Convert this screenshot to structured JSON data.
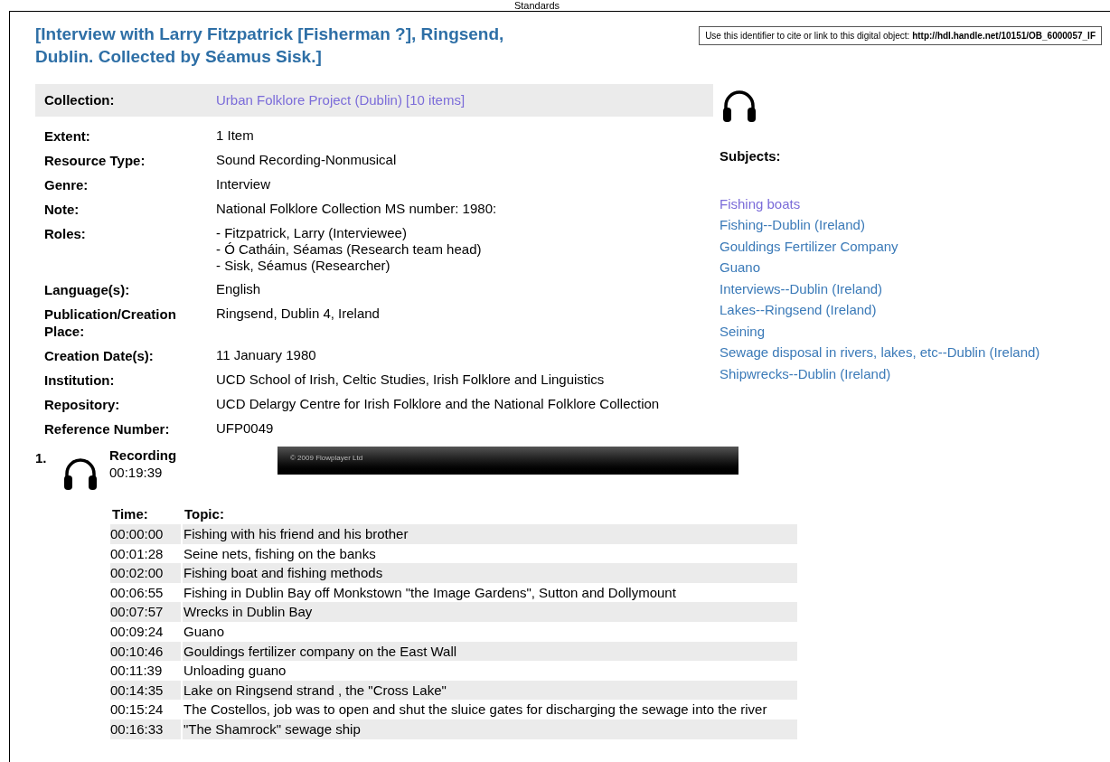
{
  "header_text": "Standards",
  "title": "[Interview with Larry Fitzpatrick [Fisherman ?], Ringsend, Dublin. Collected by Séamus Sisk.]",
  "identifier": {
    "label": "Use this identifier to cite or link to this digital object:",
    "url": "http://hdl.handle.net/10151/OB_6000057_IF"
  },
  "collection": {
    "label": "Collection:",
    "value": "Urban Folklore Project (Dublin) [10 items]",
    "visited": true
  },
  "details": [
    {
      "label": "Extent:",
      "values": [
        "1 Item"
      ]
    },
    {
      "label": "Resource Type:",
      "values": [
        "Sound Recording-Nonmusical"
      ]
    },
    {
      "label": "Genre:",
      "values": [
        "Interview"
      ]
    },
    {
      "label": "Note:",
      "values": [
        "National Folklore Collection MS number: 1980:"
      ]
    },
    {
      "label": "Roles:",
      "values": [
        "- Fitzpatrick, Larry (Interviewee)",
        "- Ó Catháin, Séamas (Research team head)",
        "- Sisk, Séamus (Researcher)"
      ]
    },
    {
      "label": "Language(s):",
      "values": [
        "English"
      ]
    },
    {
      "label": "Publication/Creation Place:",
      "values": [
        "Ringsend, Dublin 4, Ireland"
      ]
    },
    {
      "label": "Creation Date(s):",
      "values": [
        "11 January 1980"
      ]
    },
    {
      "label": "Institution:",
      "values": [
        "UCD School of Irish, Celtic Studies, Irish Folklore and Linguistics"
      ]
    },
    {
      "label": "Repository:",
      "values": [
        "UCD Delargy Centre for Irish Folklore and the National Folklore Collection"
      ]
    },
    {
      "label": "Reference Number:",
      "values": [
        "UFP0049"
      ]
    }
  ],
  "subjects": {
    "heading": "Subjects:",
    "items": [
      {
        "label": "Fishing boats",
        "visited": true
      },
      {
        "label": "Fishing--Dublin (Ireland)",
        "visited": false
      },
      {
        "label": "Gouldings Fertilizer Company",
        "visited": false
      },
      {
        "label": "Guano",
        "visited": false
      },
      {
        "label": "Interviews--Dublin (Ireland)",
        "visited": false
      },
      {
        "label": "Lakes--Ringsend (Ireland)",
        "visited": false
      },
      {
        "label": "Seining",
        "visited": false
      },
      {
        "label": "Sewage disposal in rivers, lakes, etc--Dublin (Ireland)",
        "visited": false
      },
      {
        "label": "Shipwrecks--Dublin (Ireland)",
        "visited": false
      }
    ]
  },
  "recording": {
    "number": "1.",
    "title": "Recording",
    "duration": "00:19:39",
    "player_credit": "© 2009 Flowplayer Ltd",
    "columns": [
      "Time:",
      "Topic:"
    ],
    "rows": [
      {
        "time": "00:00:00",
        "topic": "Fishing with his friend and his brother"
      },
      {
        "time": "00:01:28",
        "topic": "Seine nets, fishing on the banks"
      },
      {
        "time": "00:02:00",
        "topic": "Fishing boat and fishing methods"
      },
      {
        "time": "00:06:55",
        "topic": "Fishing in Dublin Bay off Monkstown \"the Image Gardens\", Sutton and Dollymount"
      },
      {
        "time": "00:07:57",
        "topic": "Wrecks in Dublin Bay"
      },
      {
        "time": "00:09:24",
        "topic": "Guano"
      },
      {
        "time": "00:10:46",
        "topic": "Gouldings fertilizer company on the East Wall"
      },
      {
        "time": "00:11:39",
        "topic": "Unloading guano"
      },
      {
        "time": "00:14:35",
        "topic": "Lake on Ringsend strand , the \"Cross Lake\""
      },
      {
        "time": "00:15:24",
        "topic": "The Costellos, job was to open and shut the sluice gates for discharging the sewage into the river"
      },
      {
        "time": "00:16:33",
        "topic": "\"The Shamrock\" sewage ship"
      }
    ]
  }
}
